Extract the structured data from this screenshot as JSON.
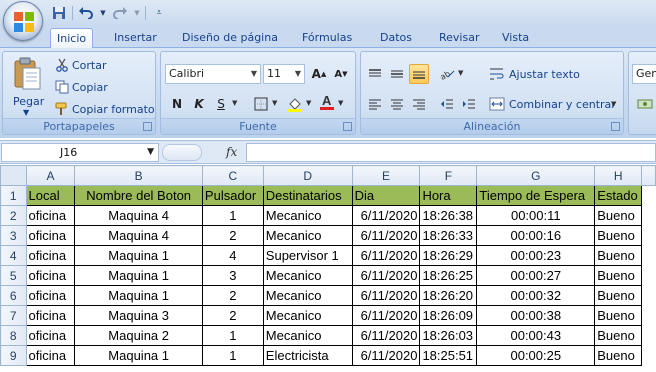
{
  "qat": {
    "save_icon": "save-icon",
    "undo_icon": "undo-icon",
    "redo_icon": "redo-icon"
  },
  "tabs": [
    {
      "label": "Inicio",
      "active": true
    },
    {
      "label": "Insertar"
    },
    {
      "label": "Diseño de página"
    },
    {
      "label": "Fórmulas"
    },
    {
      "label": "Datos"
    },
    {
      "label": "Revisar"
    },
    {
      "label": "Vista"
    }
  ],
  "ribbon": {
    "clipboard": {
      "paste": "Pegar",
      "cut": "Cortar",
      "copy": "Copiar",
      "format_painter": "Copiar formato",
      "label": "Portapapeles"
    },
    "font": {
      "name": "Calibri",
      "size": "11",
      "label": "Fuente",
      "bold": "N",
      "italic": "K",
      "underline": "S"
    },
    "alignment": {
      "wrap": "Ajustar texto",
      "merge": "Combinar y centrar",
      "label": "Alineación"
    },
    "number": {
      "format": "Gen"
    }
  },
  "formula_bar": {
    "cell_ref": "J16",
    "fx": "fx",
    "value": ""
  },
  "sheet": {
    "columns": [
      "A",
      "B",
      "C",
      "D",
      "E",
      "F",
      "G",
      "H"
    ],
    "header": [
      "Local",
      "Nombre del Boton",
      "Pulsador",
      "Destinatarios",
      "Dia",
      "Hora",
      "Tiempo de Espera",
      "Estado"
    ],
    "header_color": "#9bbb59",
    "rows": [
      [
        "oficina",
        "Maquina 4",
        "1",
        "Mecanico",
        "6/11/2020",
        "18:26:38",
        "00:00:11",
        "Bueno"
      ],
      [
        "oficina",
        "Maquina 4",
        "2",
        "Mecanico",
        "6/11/2020",
        "18:26:33",
        "00:00:16",
        "Bueno"
      ],
      [
        "oficina",
        "Maquina 1",
        "4",
        "Supervisor 1",
        "6/11/2020",
        "18:26:29",
        "00:00:23",
        "Bueno"
      ],
      [
        "oficina",
        "Maquina 1",
        "3",
        "Mecanico",
        "6/11/2020",
        "18:26:25",
        "00:00:27",
        "Bueno"
      ],
      [
        "oficina",
        "Maquina 1",
        "2",
        "Mecanico",
        "6/11/2020",
        "18:26:20",
        "00:00:32",
        "Bueno"
      ],
      [
        "oficina",
        "Maquina 3",
        "2",
        "Mecanico",
        "6/11/2020",
        "18:26:09",
        "00:00:38",
        "Bueno"
      ],
      [
        "oficina",
        "Maquina 2",
        "1",
        "Mecanico",
        "6/11/2020",
        "18:26:03",
        "00:00:43",
        "Bueno"
      ],
      [
        "oficina",
        "Maquina 1",
        "1",
        "Electricista",
        "6/11/2020",
        "18:25:51",
        "00:00:25",
        "Bueno"
      ]
    ],
    "row_numbers": [
      "1",
      "2",
      "3",
      "4",
      "5",
      "6",
      "7",
      "8",
      "9"
    ]
  }
}
